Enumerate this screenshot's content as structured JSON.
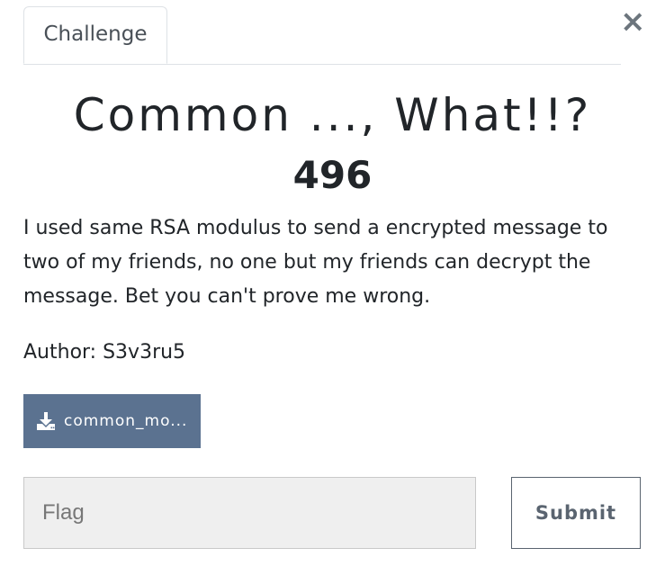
{
  "tabs": [
    {
      "label": "Challenge",
      "active": true
    }
  ],
  "close_label": "×",
  "challenge": {
    "name": "Common ..., What!!?",
    "points": "496",
    "description": "I used same RSA modulus to send a encrypted message to two of my friends, no one but my friends can decrypt the message. Bet you can't prove me wrong.",
    "author": "Author: S3v3ru5",
    "file": {
      "name": "common_modulus.txt",
      "display": "common_mo...",
      "icon": "download-icon"
    }
  },
  "flag_form": {
    "placeholder": "Flag",
    "value": "",
    "submit_label": "Submit"
  },
  "colors": {
    "download_bg": "#5b7290",
    "input_bg": "#efefef",
    "submit_border": "#5a6470"
  }
}
